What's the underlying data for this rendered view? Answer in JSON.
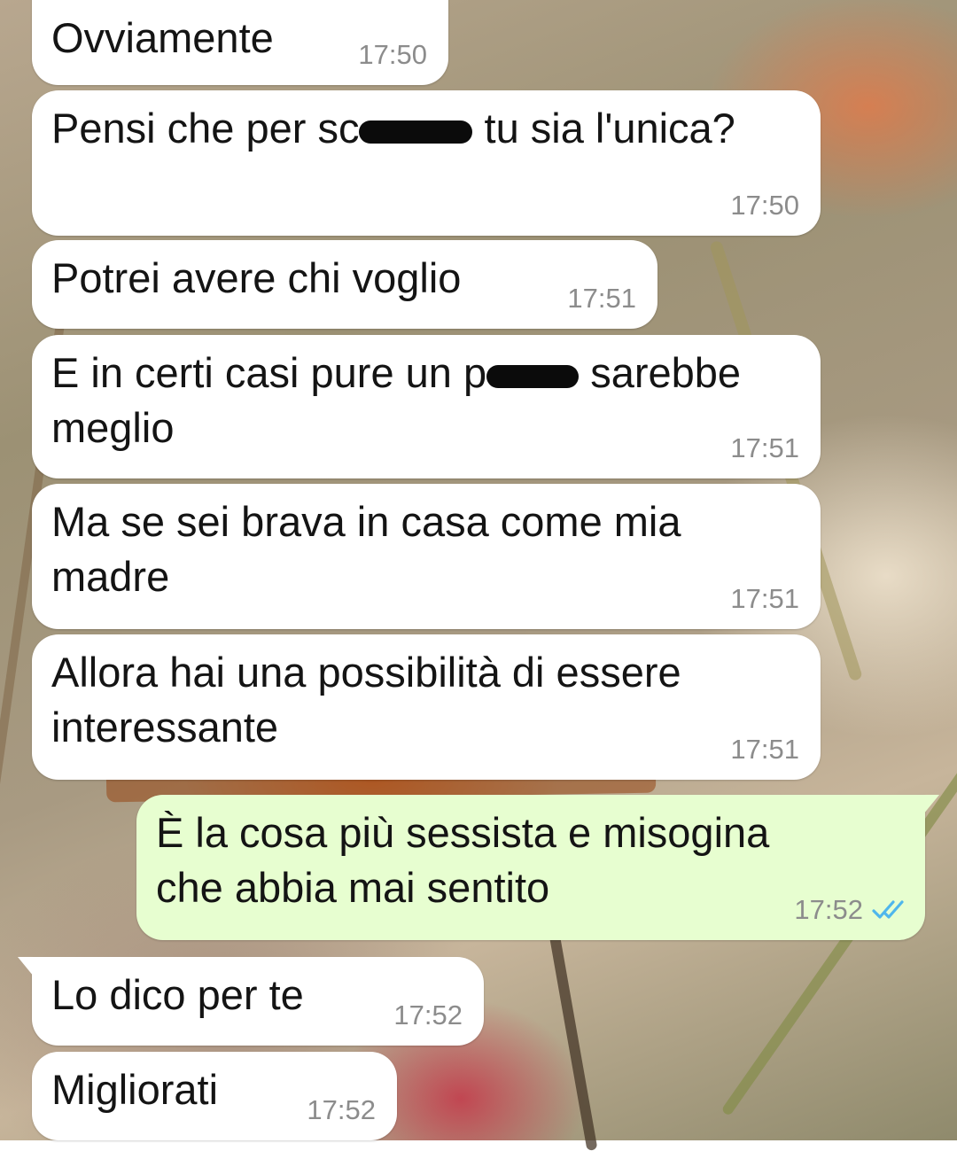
{
  "conversation": {
    "messages": [
      {
        "direction": "in",
        "text": "Ovviamente",
        "time": "17:50"
      },
      {
        "direction": "in",
        "text_before": "Pensi che per sc",
        "text_after": " tu sia l'unica?",
        "time": "17:50",
        "redacted": true
      },
      {
        "direction": "in",
        "text": "Potrei avere chi voglio",
        "time": "17:51"
      },
      {
        "direction": "in",
        "line1_before": "E in certi casi pure un p",
        "line1_after": " sarebbe",
        "line2": "meglio",
        "time": "17:51",
        "redacted": true
      },
      {
        "direction": "in",
        "line1": "Ma se sei brava in casa come mia",
        "line2": "madre",
        "time": "17:51"
      },
      {
        "direction": "in",
        "line1": "Allora hai una possibilità di essere",
        "line2": "interessante",
        "time": "17:51"
      },
      {
        "direction": "out",
        "line1": "È la cosa più sessista e misogina",
        "line2": "che abbia mai sentito",
        "time": "17:52",
        "status_icon": "double-check-read-icon",
        "status_color": "#4fb6ec"
      },
      {
        "direction": "in",
        "text": "Lo dico per te",
        "time": "17:52"
      },
      {
        "direction": "in",
        "text": "Migliorati",
        "time": "17:52"
      }
    ]
  },
  "colors": {
    "incoming_bubble": "#ffffff",
    "outgoing_bubble": "#e7fed0",
    "timestamp": "#8c8c8c",
    "read_check": "#4fb6ec"
  }
}
